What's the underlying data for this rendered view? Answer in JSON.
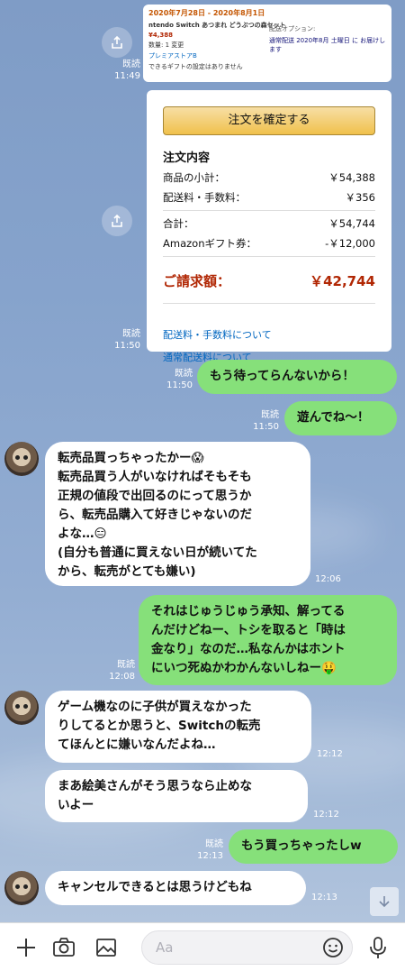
{
  "chat": {
    "read_label": "既読",
    "image1": {
      "time": "11:49",
      "date_text": "2020年7月28日 - 2020年8月1日",
      "product_text": "ntendo Switch あつまれ どうぶつの森セット",
      "price_text": "¥4,388",
      "qty_text": "数量: 1 変更",
      "seller_text": "プレミアストアB",
      "gift_text": "できるギフトの設定はありません",
      "delivery_label": "配送オプション:",
      "delivery_option": "通常配送 2020年8月 土曜日 に お届けします"
    },
    "image2": {
      "time": "11:50",
      "confirm_button": "注文を確定する",
      "summary_title": "注文内容",
      "rows": [
        {
          "label": "商品の小計：",
          "value": "￥54,388"
        },
        {
          "label": "配送料・手数料：",
          "value": "￥356"
        },
        {
          "label": "合計：",
          "value": "￥54,744"
        },
        {
          "label": "Amazonギフト券：",
          "value": "-￥12,000"
        }
      ],
      "total_label": "ご請求額：",
      "total_value": "￥42,744",
      "link1": "配送料・手数料について",
      "link2": "通常配送料について"
    },
    "messages": [
      {
        "side": "right",
        "text": "もう待ってらんないから！",
        "time": "11:50",
        "read": true
      },
      {
        "side": "right",
        "text": "遊んでね〜！",
        "time": "11:50",
        "read": true
      },
      {
        "side": "left",
        "text": "転売品買っちゃったかー😱\n転売品買う人がいなければそもそも\n正規の値段で出回るのにって思うか\nら、転売品購入て好きじゃないのだ\nよな…😑\n(自分も普通に買えない日が続いてた\nから、転売がとても嫌い)",
        "time": "12:06"
      },
      {
        "side": "right",
        "text": "それはじゅうじゅう承知、解ってる\nんだけどねー、トシを取ると「時は\n金なり」なのだ…私なんかはホント\nにいつ死ぬかわかんないしねー🤑",
        "time": "12:08",
        "read": true
      },
      {
        "side": "left",
        "text": "ゲーム機なのに子供が買えなかった\nりしてるとか思うと、Switchの転売\nてほんとに嫌いなんだよね…",
        "time": "12:12"
      },
      {
        "side": "left",
        "text": "まあ絵美さんがそう思うなら止めな\nいよー",
        "time": "12:12"
      },
      {
        "side": "right",
        "text": "もう買っちゃったしw",
        "time": "12:13",
        "read": true
      },
      {
        "side": "left",
        "text": "キャンセルできるとは思うけどもね",
        "time": "12:13"
      }
    ]
  },
  "input": {
    "placeholder": "Aa"
  },
  "colors": {
    "bubble_green": "#86e07a",
    "bubble_white": "#ffffff",
    "amazon_red": "#b12704",
    "amazon_link": "#0066c0"
  }
}
